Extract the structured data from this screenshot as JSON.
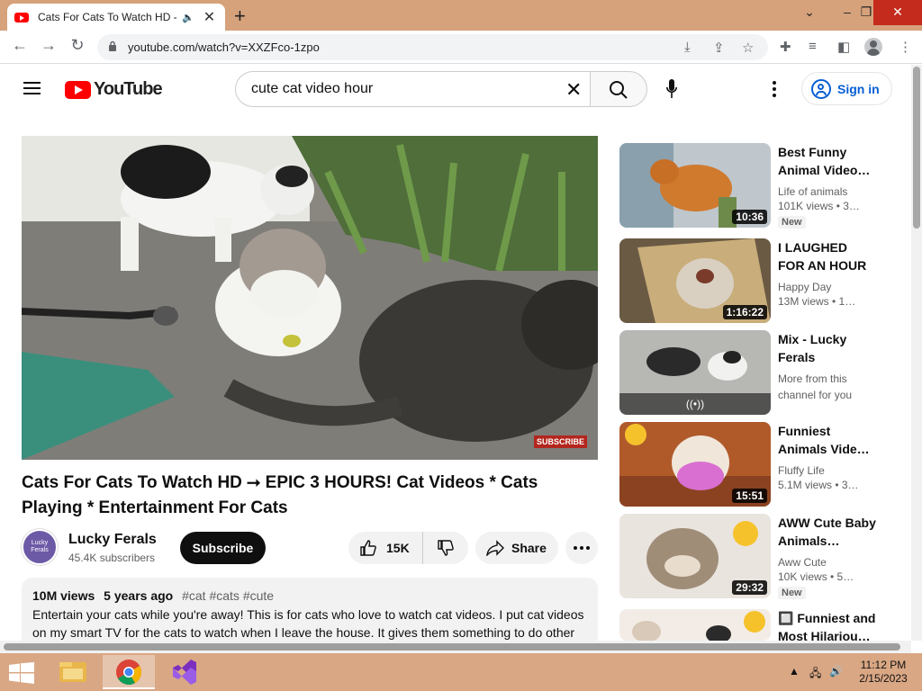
{
  "browser": {
    "tab_title": "Cats For Cats To Watch HD ⭢",
    "url": "youtube.com/watch?v=XXZFco-1zpo",
    "new_tab": "+",
    "tab_close": "✕",
    "speaker": "🔈"
  },
  "youtube": {
    "logo_text": "YouTube",
    "search_query": "cute cat video hour",
    "sign_in": "Sign in"
  },
  "video": {
    "watermark": "Lucky Ferals",
    "subscribe_watermark": "SUBSCRIBE",
    "title": "Cats For Cats To Watch HD ⭢ EPIC 3 HOURS! Cat Videos * Cats Playing * Entertainment For Cats",
    "channel": "Lucky Ferals",
    "subscribers": "45.4K subscribers",
    "subscribe_label": "Subscribe",
    "likes": "15K",
    "share_label": "Share",
    "views": "10M views",
    "age": "5 years ago",
    "tags": "#cat #cats #cute",
    "description": "Entertain your cats while you're away! This is for cats who love to watch cat videos. I put cat videos on my smart TV for the cats to watch when I leave the house. It gives them something to do other"
  },
  "recommendations": [
    {
      "title": "Best Funny Animal Video…",
      "channel": "Life of animals",
      "views": "101K views  • 3…",
      "duration": "10:36",
      "badge": "New"
    },
    {
      "title": "I LAUGHED FOR AN HOUR😹…",
      "channel": "Happy Day",
      "views": "13M views  • 1…",
      "duration": "1:16:22",
      "badge": ""
    },
    {
      "title": "Mix - Lucky Ferals",
      "channel": "More from this channel for you",
      "views": "",
      "duration": "",
      "badge": "",
      "mix_icon": "((•))"
    },
    {
      "title": "Funniest Animals Vide…",
      "channel": "Fluffy Life",
      "views": "5.1M views  • 3…",
      "duration": "15:51",
      "badge": ""
    },
    {
      "title": "AWW Cute Baby Animals…",
      "channel": "Aww Cute",
      "views": "10K views  • 5…",
      "duration": "29:32",
      "badge": "New"
    },
    {
      "title": "🔲 Funniest and Most Hilariou…",
      "channel": "",
      "views": "",
      "duration": "",
      "badge": ""
    }
  ],
  "taskbar": {
    "time": "11:12 PM",
    "date": "2/15/2023"
  },
  "colors": {
    "youtube_red": "#ff0000",
    "link_blue": "#065fd4",
    "taskbar": "#d9a784",
    "tabstrip": "#d6a27b"
  }
}
